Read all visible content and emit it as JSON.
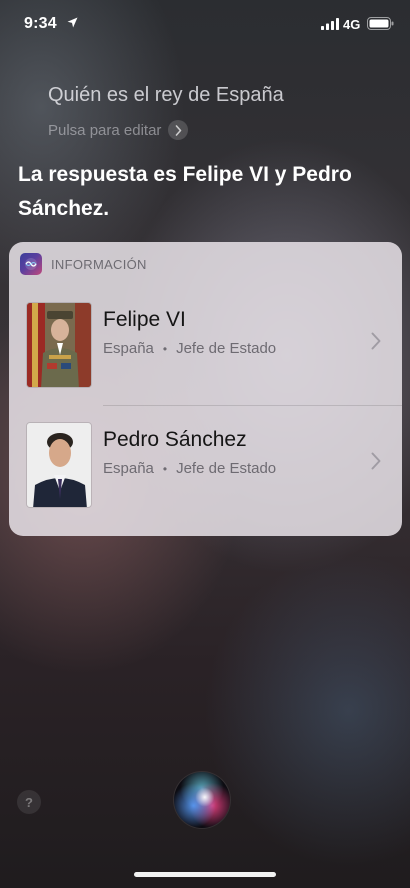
{
  "status_bar": {
    "time": "9:34",
    "network": "4G",
    "icons": [
      "location-arrow-icon",
      "cellular-signal-icon",
      "battery-icon"
    ]
  },
  "query": {
    "text": "Quién es el rey de España",
    "edit_label": "Pulsa para editar"
  },
  "answer": "La respuesta es Felipe VI y Pedro Sánchez.",
  "card": {
    "title": "INFORMACIÓN",
    "results": [
      {
        "name": "Felipe VI",
        "country": "España",
        "role": "Jefe de Estado"
      },
      {
        "name": "Pedro Sánchez",
        "country": "España",
        "role": "Jefe de Estado"
      }
    ]
  },
  "bottom": {
    "help_glyph": "?",
    "icons": [
      "help-icon",
      "siri-orb-icon"
    ]
  },
  "colors": {
    "card_bg": "#e8e2e8",
    "name_text": "#151515",
    "meta_text": "#6e6b72"
  }
}
